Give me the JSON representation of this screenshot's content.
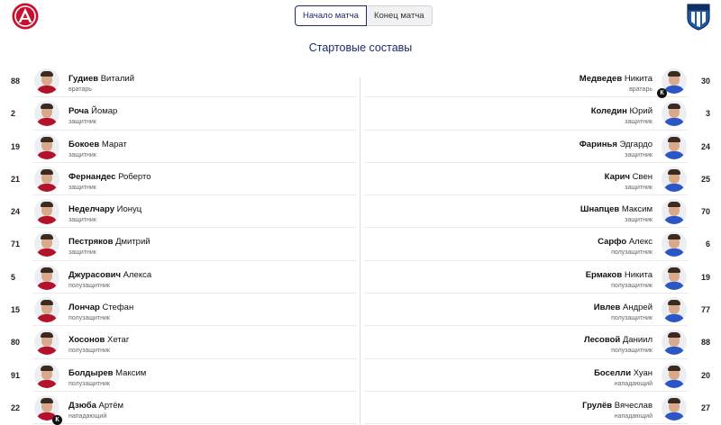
{
  "header": {
    "tabs": [
      {
        "label": "Начало матча",
        "active": true
      },
      {
        "label": "Конец матча",
        "active": false
      }
    ],
    "home_logo_icon": "akhmat-crest-icon",
    "away_logo_icon": "pari-nn-crest-icon",
    "accent_color": "#1b2a6b"
  },
  "section_title": "Стартовые составы",
  "captain_badge": "К",
  "home": {
    "primary_color": "#b3122b",
    "players": [
      {
        "number": "88",
        "last": "Гудиев",
        "first": "Виталий",
        "position": "вратарь",
        "captain": false
      },
      {
        "number": "2",
        "last": "Роча",
        "first": "Йомар",
        "position": "защитник",
        "captain": false
      },
      {
        "number": "19",
        "last": "Бокоев",
        "first": "Марат",
        "position": "защитник",
        "captain": false
      },
      {
        "number": "21",
        "last": "Фернандес",
        "first": "Роберто",
        "position": "защитник",
        "captain": false
      },
      {
        "number": "24",
        "last": "Неделчару",
        "first": "Ионуц",
        "position": "защитник",
        "captain": false
      },
      {
        "number": "71",
        "last": "Пестряков",
        "first": "Дмитрий",
        "position": "защитник",
        "captain": false
      },
      {
        "number": "5",
        "last": "Джурасович",
        "first": "Алекса",
        "position": "полузащитник",
        "captain": false
      },
      {
        "number": "15",
        "last": "Лончар",
        "first": "Стефан",
        "position": "полузащитник",
        "captain": false
      },
      {
        "number": "80",
        "last": "Хосонов",
        "first": "Хетаг",
        "position": "полузащитник",
        "captain": false
      },
      {
        "number": "91",
        "last": "Болдырев",
        "first": "Максим",
        "position": "полузащитник",
        "captain": false
      },
      {
        "number": "22",
        "last": "Дзюба",
        "first": "Артём",
        "position": "нападающий",
        "captain": true
      }
    ]
  },
  "away": {
    "primary_color": "#2a56c6",
    "players": [
      {
        "number": "30",
        "last": "Медведев",
        "first": "Никита",
        "position": "вратарь",
        "captain": true
      },
      {
        "number": "3",
        "last": "Коледин",
        "first": "Юрий",
        "position": "защитник",
        "captain": false
      },
      {
        "number": "24",
        "last": "Фаринья",
        "first": "Эдгардо",
        "position": "защитник",
        "captain": false
      },
      {
        "number": "25",
        "last": "Карич",
        "first": "Свен",
        "position": "защитник",
        "captain": false
      },
      {
        "number": "70",
        "last": "Шнапцев",
        "first": "Максим",
        "position": "защитник",
        "captain": false
      },
      {
        "number": "6",
        "last": "Сарфо",
        "first": "Алекс",
        "position": "полузащитник",
        "captain": false
      },
      {
        "number": "19",
        "last": "Ермаков",
        "first": "Никита",
        "position": "полузащитник",
        "captain": false
      },
      {
        "number": "77",
        "last": "Ивлев",
        "first": "Андрей",
        "position": "полузащитник",
        "captain": false
      },
      {
        "number": "88",
        "last": "Лесовой",
        "first": "Даниил",
        "position": "полузащитник",
        "captain": false
      },
      {
        "number": "20",
        "last": "Боселли",
        "first": "Хуан",
        "position": "нападающий",
        "captain": false
      },
      {
        "number": "27",
        "last": "Грулёв",
        "first": "Вячеслав",
        "position": "нападающий",
        "captain": false
      }
    ]
  }
}
